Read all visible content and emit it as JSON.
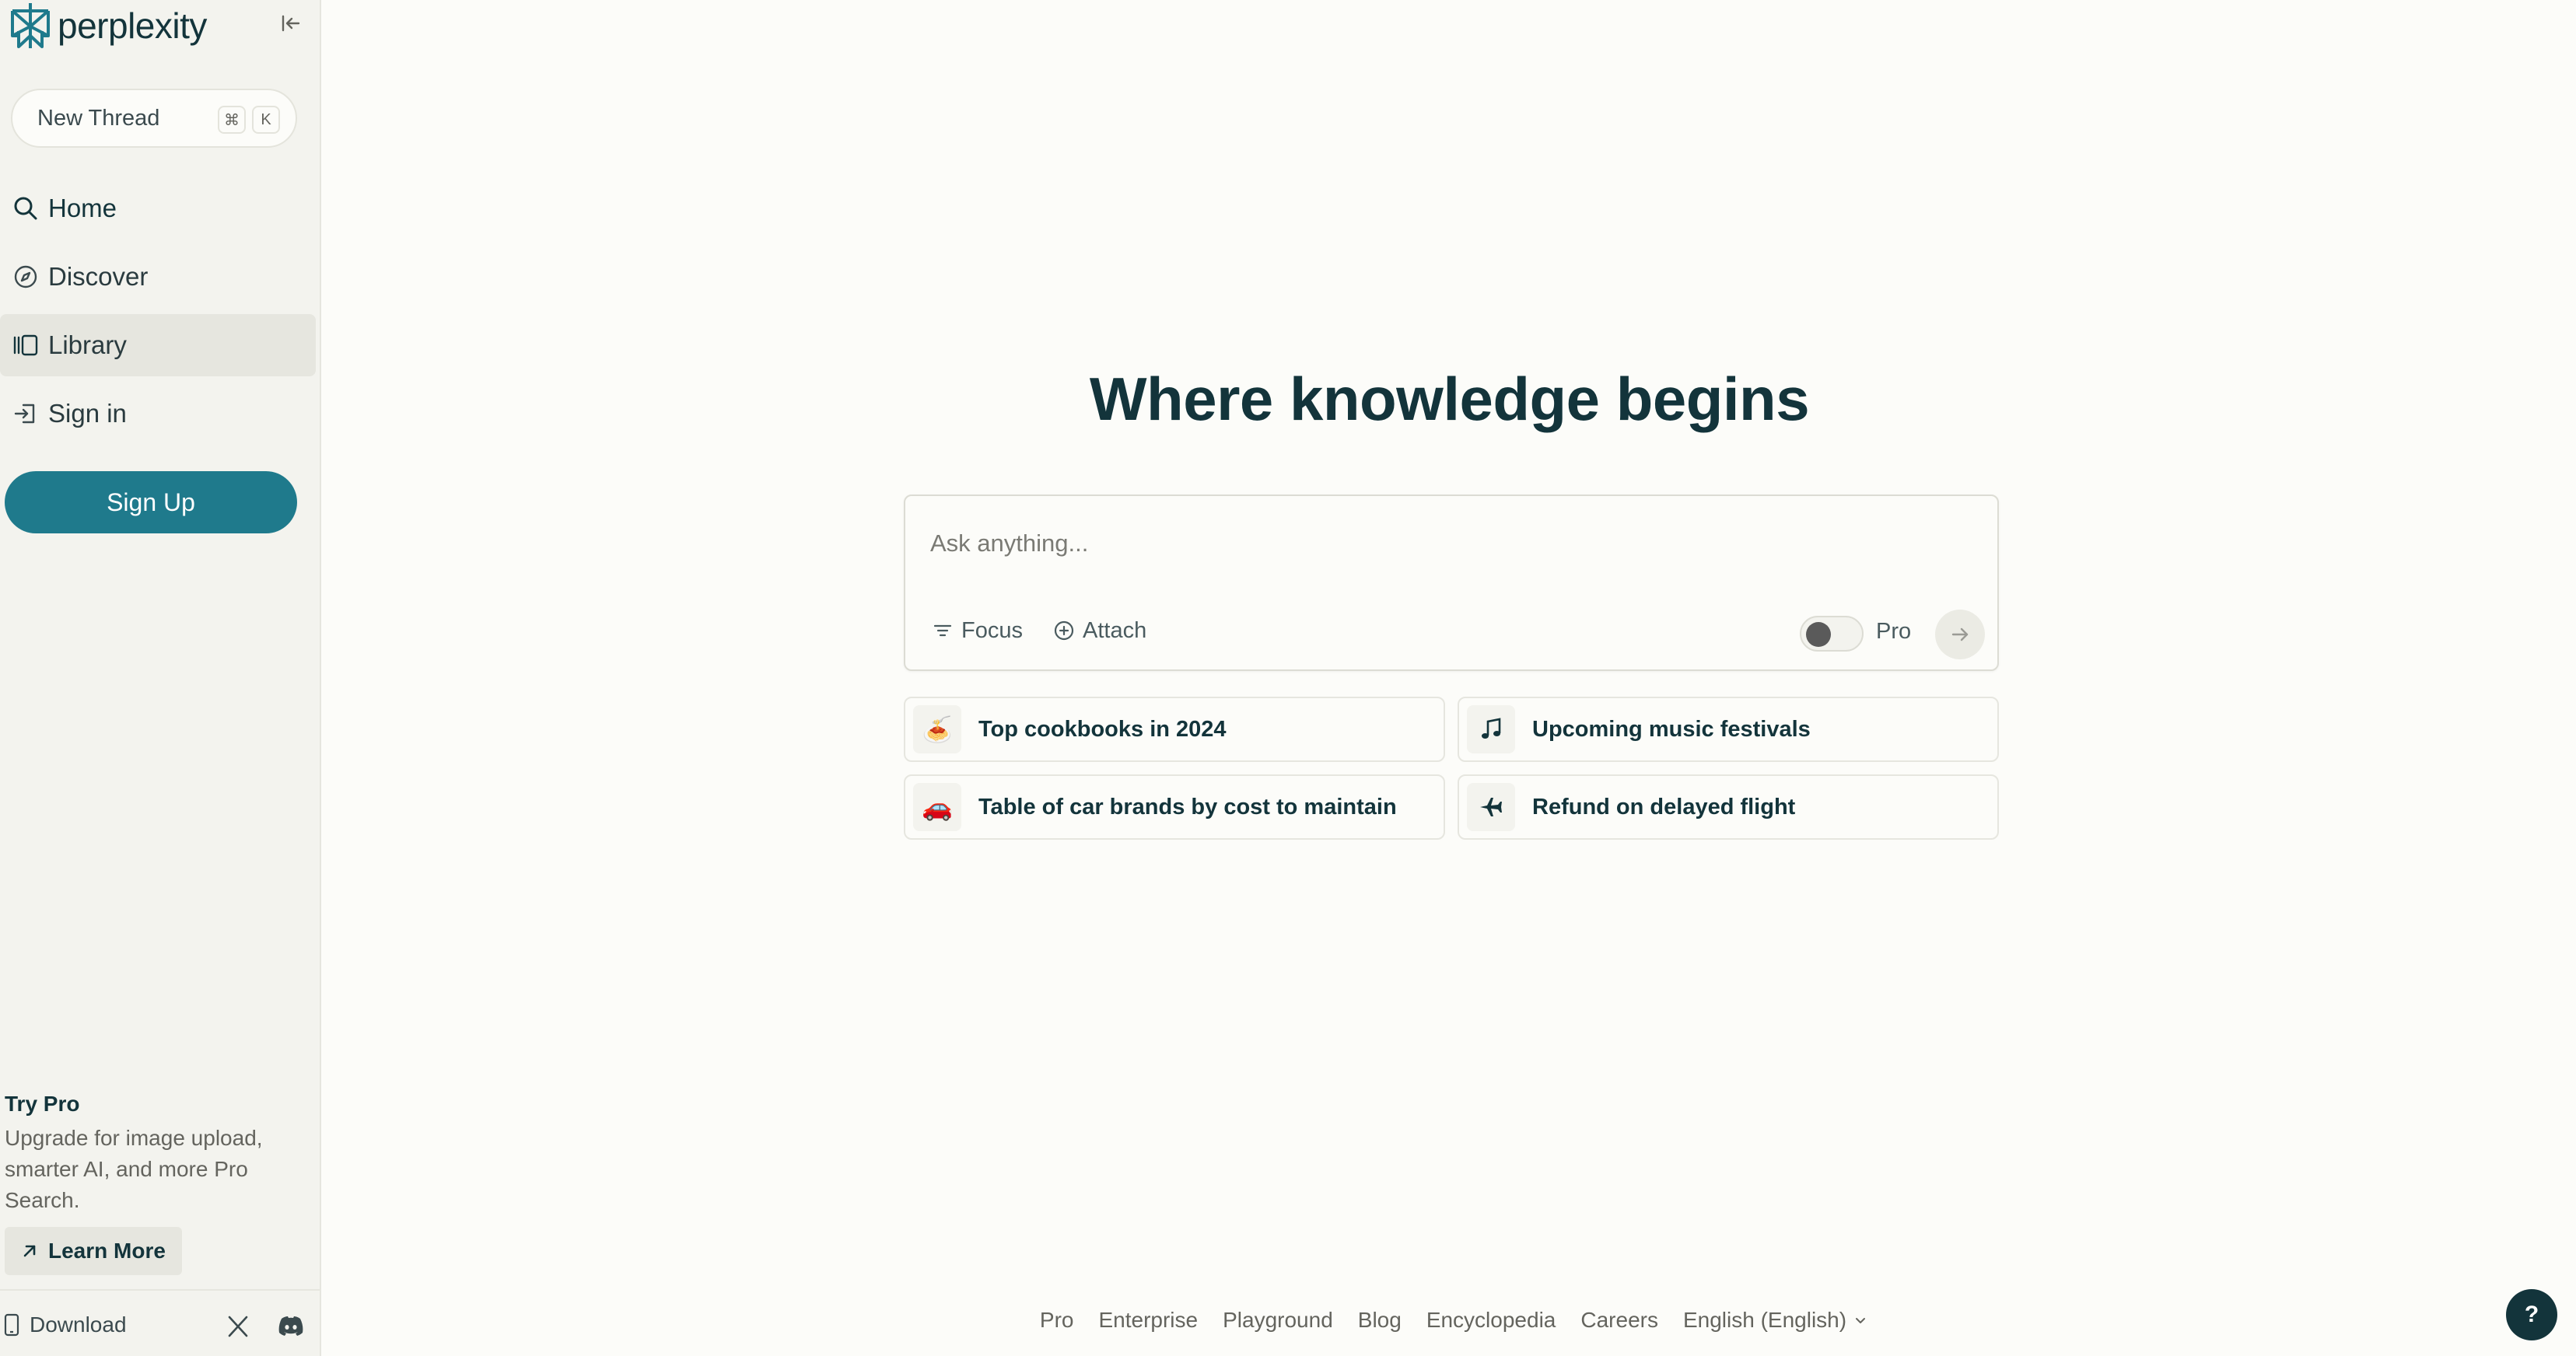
{
  "app": {
    "brand": "perplexity",
    "logo_icon": "perplexity-logo-icon",
    "accent_color": "#1f7a8c",
    "text_color": "#13343b"
  },
  "sidebar": {
    "new_thread": {
      "label": "New Thread",
      "shortcut_mod": "⌘",
      "shortcut_key": "K"
    },
    "nav": [
      {
        "label": "Home",
        "icon": "search-icon"
      },
      {
        "label": "Discover",
        "icon": "compass-icon"
      },
      {
        "label": "Library",
        "icon": "library-icon"
      },
      {
        "label": "Sign in",
        "icon": "sign-in-icon"
      }
    ],
    "signup_label": "Sign Up",
    "try_pro": {
      "title": "Try Pro",
      "description": "Upgrade for image upload, smarter AI, and more Pro Search.",
      "learn_more": "Learn More"
    },
    "footer": {
      "download": "Download"
    }
  },
  "main": {
    "headline": "Where knowledge begins",
    "search": {
      "placeholder": "Ask anything...",
      "focus_label": "Focus",
      "attach_label": "Attach",
      "pro_label": "Pro"
    },
    "suggestions": [
      {
        "emoji": "🍝",
        "label": "Top cookbooks in 2024"
      },
      {
        "emoji": "🎵",
        "label": "Upcoming music festivals"
      },
      {
        "emoji": "🚗",
        "label": "Table of car brands by cost to maintain"
      },
      {
        "emoji": "✈",
        "label": "Refund on delayed flight"
      }
    ],
    "footer_links": [
      "Pro",
      "Enterprise",
      "Playground",
      "Blog",
      "Encyclopedia",
      "Careers"
    ],
    "language": "English (English)",
    "help_label": "?"
  }
}
